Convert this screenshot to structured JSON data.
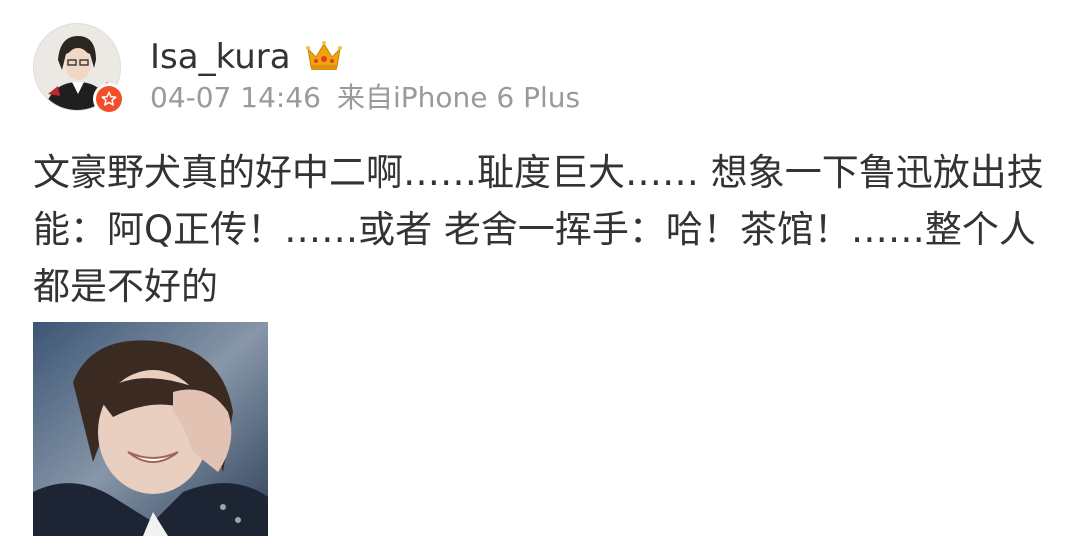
{
  "post": {
    "username": "Isa_kura",
    "timestamp": "04-07 14:46",
    "source": "来自iPhone 6 Plus",
    "text": "文豪野犬真的好中二啊……耻度巨大…… 想象一下鲁迅放出技能：阿Q正传！……或者 老舍一挥手：哈！茶馆！……整个人都是不好的",
    "badge_icon": "verified-star-icon",
    "vip_icon": "crown-icon",
    "colors": {
      "badge": "#f24e2a",
      "crown": "#f0a30a",
      "meta_text": "#9a9a9a",
      "body_text": "#333333"
    }
  }
}
